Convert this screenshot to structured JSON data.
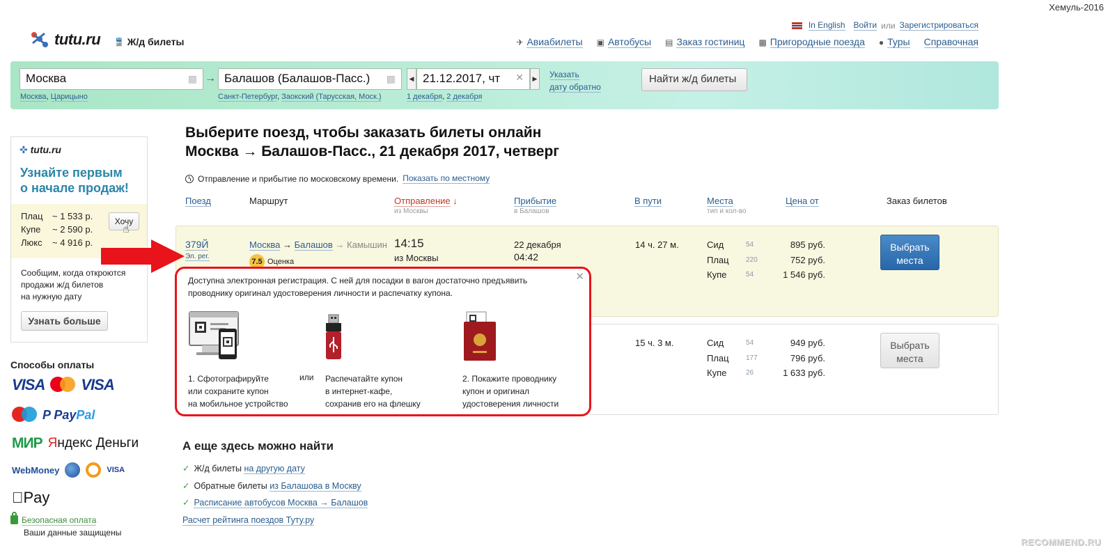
{
  "watermark": {
    "user": "Хемуль-2016",
    "site": "RECOMMEND.RU"
  },
  "header": {
    "logo": "tutu.ru",
    "section": "Ж/д билеты",
    "lang": "In English",
    "login": "Войти",
    "or": "или",
    "register": "Зарегистрироваться",
    "nav": [
      "Авиабилеты",
      "Автобусы",
      "Заказ гостиниц",
      "Пригородные поезда",
      "Туры",
      "Справочная"
    ]
  },
  "search": {
    "from": "Москва",
    "from_hints": [
      "Москва",
      "Царицыно"
    ],
    "to": "Балашов (Балашов-Пасс.)",
    "to_hints": [
      "Санкт-Петербург",
      "Заокский (Тарусская, Моск.)"
    ],
    "date": "21.12.2017, чт",
    "date_hints": [
      "1 декабря",
      "2 декабря"
    ],
    "return_link_1": "Указать",
    "return_link_2": "дату обратно",
    "find_button": "Найти ж/д билеты"
  },
  "promo": {
    "logo": "tutu.ru",
    "title_1": "Узнайте первым",
    "title_2": "о начале продаж!",
    "prices": [
      {
        "type": "Плац",
        "price": "~ 1 533 р."
      },
      {
        "type": "Купе",
        "price": "~ 2 590 р."
      },
      {
        "type": "Люкс",
        "price": "~ 4 916 р."
      }
    ],
    "want_button": "Хочу",
    "text_1": "Сообщим, когда откроются",
    "text_2": "продажи ж/д билетов",
    "text_3": "на нужную дату",
    "more_button": "Узнать больше"
  },
  "payments": {
    "title": "Способы оплаты",
    "secure_link": "Безопасная оплата",
    "secure_text": "Ваши данные защищены"
  },
  "main": {
    "title_1": "Выберите поезд, чтобы заказать билеты онлайн",
    "title_2": "Москва → Балашов-Пасс., 21 декабря 2017, четверг",
    "tz_text": "Отправление и прибытие по московскому времени.",
    "tz_link": "Показать по местному",
    "columns": {
      "train": "Поезд",
      "route": "Маршрут",
      "departure": "Отправление",
      "departure_sub": "из Москвы",
      "arrival": "Прибытие",
      "arrival_sub": "в Балашов",
      "duration": "В пути",
      "seats": "Места",
      "seats_sub": "тип и кол-во",
      "price": "Цена от",
      "order": "Заказ билетов"
    },
    "trains": [
      {
        "number": "379Й",
        "reg": "Эл. рег.",
        "route_from": "Москва",
        "route_to": "Балашов",
        "route_end": "→ Камышин",
        "rating": "7.5",
        "rating_label": "Оценка",
        "dep_time": "14:15",
        "dep_station": "из Москвы",
        "arr_date": "22 декабря",
        "arr_time": "04:42",
        "duration": "14 ч. 27 м.",
        "seats": [
          {
            "type": "Сид",
            "count": "54",
            "price": "895 руб."
          },
          {
            "type": "Плац",
            "count": "220",
            "price": "752 руб."
          },
          {
            "type": "Купе",
            "count": "54",
            "price": "1 546 руб."
          }
        ],
        "button_1": "Выбрать",
        "button_2": "места"
      },
      {
        "duration": "15 ч. 3 м.",
        "seats": [
          {
            "type": "Сид",
            "count": "54",
            "price": "949 руб."
          },
          {
            "type": "Плац",
            "count": "177",
            "price": "796 руб."
          },
          {
            "type": "Купе",
            "count": "26",
            "price": "1 633 руб."
          }
        ],
        "button_1": "Выбрать",
        "button_2": "места"
      }
    ]
  },
  "popup": {
    "text_1": "Доступна электронная регистрация. С ней для посадки в вагон достаточно предъявить",
    "text_2": "проводнику оригинал удостоверения личности и распечатку купона.",
    "step1": [
      "1. Сфотографируйте",
      "или сохраните купон",
      "на мобильное устройство"
    ],
    "or": "или",
    "step2": [
      "Распечатайте купон",
      "в интернет-кафе,",
      "сохранив его на флешку"
    ],
    "step3": [
      "2. Покажите проводнику",
      "купон и оригинал",
      "удостоверения личности"
    ]
  },
  "more": {
    "title": "А еще здесь можно найти",
    "item1_text": "Ж/д билеты",
    "item1_link": "на другую дату",
    "item2_text": "Обратные билеты",
    "item2_link": "из Балашова в Москву",
    "item3_link": "Расписание автобусов Москва → Балашов",
    "rating_link": "Расчет рейтинга поездов Туту.ру"
  },
  "colors": {
    "accent_red": "#e8131b",
    "link": "#2a5d8f",
    "promo_blue": "#2a86a8",
    "button_blue": "#2766a8"
  }
}
